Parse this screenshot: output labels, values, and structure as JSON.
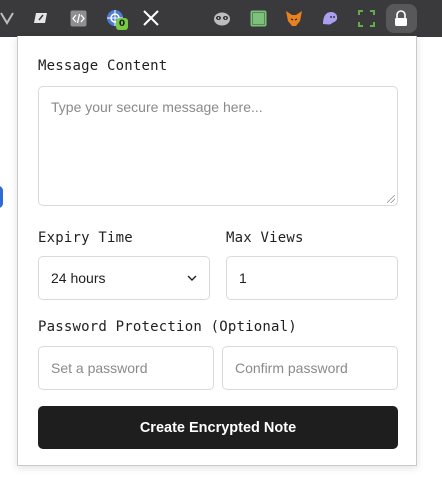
{
  "toolbar": {
    "icons": [
      {
        "name": "extension-menu-icon",
        "glyph": "▾"
      },
      {
        "name": "brush-extension-icon",
        "glyph": "✎"
      },
      {
        "name": "code-extension-icon",
        "glyph": "‹/›"
      },
      {
        "name": "vpn-extension-icon",
        "glyph": "◉",
        "badge": "0"
      },
      {
        "name": "x-extension-icon",
        "glyph": "𝕏"
      },
      {
        "name": "raccoon-extension-icon",
        "glyph": "☻"
      },
      {
        "name": "green-square-extension-icon",
        "glyph": "▣"
      },
      {
        "name": "metamask-fox-icon",
        "glyph": "♞"
      },
      {
        "name": "ghost-extension-icon",
        "glyph": "ღ"
      },
      {
        "name": "selection-extension-icon",
        "glyph": "⬚"
      },
      {
        "name": "lock-extension-icon",
        "glyph": "🔒"
      }
    ],
    "colors": {
      "background": "#3a3a3c",
      "active": "#58585a",
      "badge": "#7ac943"
    }
  },
  "form": {
    "message": {
      "label": "Message Content",
      "placeholder": "Type your secure message here..."
    },
    "expiry": {
      "label": "Expiry Time",
      "selected": "24 hours"
    },
    "max_views": {
      "label": "Max Views",
      "value": "1"
    },
    "password": {
      "label": "Password Protection (Optional)",
      "set_placeholder": "Set a password",
      "confirm_placeholder": "Confirm password"
    },
    "submit_label": "Create Encrypted Note"
  },
  "colors": {
    "button_bg": "#1e1e1e",
    "border": "#d9d9d9"
  }
}
